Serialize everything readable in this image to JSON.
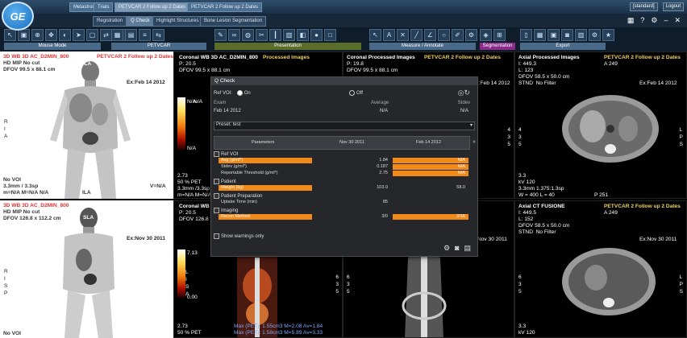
{
  "app": {
    "logo": "GE",
    "top_tabs": [
      {
        "label": "Metastroinnana",
        "active": false
      },
      {
        "label": "Trials",
        "active": false
      },
      {
        "label": "PETVCAR 2 Follow up 2 Dates",
        "active": true
      },
      {
        "label": "PETVCAR 2 Follow up 2 Dates",
        "active": false
      }
    ],
    "right_user": "[standard]",
    "logout": "Logout",
    "help": "?"
  },
  "sub_tabs": [
    {
      "label": "Registration",
      "active": false
    },
    {
      "label": "Q Check",
      "active": true
    },
    {
      "label": "Highlight Structures",
      "active": false
    },
    {
      "label": "Bone Lesion Segmentation",
      "active": false
    }
  ],
  "toolbar_groups": [
    {
      "name": "Mouse Mode",
      "icons": [
        "arrow-icon",
        "crop-icon",
        "zoom-icon",
        "pan-icon",
        "brightness-icon",
        "cursor-icon",
        "window-icon",
        "move-icon",
        "rotate-icon"
      ]
    },
    {
      "name": "PETVCAR",
      "icons": [
        "grid-icon",
        "layout-icon",
        "bars-icon",
        "swap-icon"
      ]
    },
    {
      "name": "Presentation",
      "icons": [
        "tool-icon",
        "link-icon",
        "paint-icon",
        "scissors-icon",
        "ruler-icon",
        "book-icon",
        "cube-icon",
        "blob-icon",
        "box-icon"
      ]
    },
    {
      "name": "Measure / Annotate",
      "icons": [
        "pointer-icon",
        "text-icon",
        "cross-icon",
        "line-icon",
        "angle-icon",
        "circle-icon",
        "draw-icon",
        "gear-icon"
      ]
    },
    {
      "name": "Segmentation",
      "icons": [
        "segment-icon",
        "merge-icon"
      ]
    },
    {
      "name": "Export",
      "icons": [
        "document-icon",
        "grid2-icon",
        "film-icon",
        "camera-icon",
        "film2-icon",
        "settings-icon",
        "run-icon"
      ]
    }
  ],
  "viewports": {
    "v1": {
      "title": "3D WB 3D AC_D2MIN_800",
      "series": "PETVCAR 2 Follow up 2 Dates",
      "l2": "HD MIP No cut",
      "l3": "DFOV 99.5 x 88.1 cm",
      "date": "Ex:Feb 14 2012",
      "ticks_left": [
        "R",
        "I",
        "A"
      ],
      "ticks_right": [
        "L",
        "P",
        "S"
      ],
      "cbar_top": "N/A",
      "cbar_bot": "N/A",
      "bottom": [
        "No VOI",
        "3.3mm / 3.3sp",
        "m=N/A M=N/A N/A"
      ],
      "bottom_right": "V=N/A",
      "label_mid": "ILA",
      "orient": "SLA"
    },
    "v2": {
      "title": "Coronal WB 3D AC_D2MIN_800",
      "sub": "Processed Images",
      "l2": "P: 20.5",
      "l3": "DFOV 99.5 x 88.1 cm",
      "bot1": "2.73",
      "bot2": "50 % PET",
      "bot3": "3.3mm /3.3sp",
      "bot4": "m=N/A M=N/A",
      "vnum": "N/A"
    },
    "v3": {
      "title": "Coronal Processed Images",
      "series": "PETVCAR 2 Follow up 2 Dates",
      "l2": "P: 19.8",
      "l3": "DFOV 99.5 x 88.1 cm",
      "date": "Ex:Feb 14 2012",
      "right_nums": [
        "4",
        "3",
        "5"
      ]
    },
    "v4": {
      "title": "Axial Processed Images",
      "series": "PETVCAR 2 Follow up 2 Dates",
      "l1": "I: 449.3",
      "l1b": "A 249",
      "l2": "L: 123",
      "l3": "DFOV 58.5 x 50.0 cm",
      "l4": "STND  No Filter",
      "date": "Ex:Feb 14 2012",
      "left_nums": [
        "4",
        "3",
        "5"
      ],
      "right_ticks": [
        "L",
        "P",
        "S"
      ],
      "bottom": [
        "3.3",
        "kV 120",
        "3.3mm 1.375:1.3sp",
        "W = 400 L = 40"
      ],
      "bottom_right": "P 251"
    },
    "v5": {
      "title": "3D WB 3D AC_D2MIN_800",
      "l2": "HD MIP No cut",
      "l3": "DFOV 126.8 x 112.2 cm",
      "date": "Ex:Nov 30 2011",
      "ticks_left": [
        "R",
        "I",
        "S",
        "P"
      ],
      "ticks_right": [
        "L",
        "I",
        "S",
        "A"
      ],
      "cbar_top": "7.13",
      "cbar_bot": "0.00",
      "bottom": [
        "No VOI"
      ],
      "orient": "SLA"
    },
    "v6": {
      "title": "Coronal WB 3D AC",
      "l2": "P: 20.5",
      "l3": "DFOV 126.8",
      "right_nums": [
        "6",
        "3",
        "5"
      ],
      "bottom": [
        "2.73",
        "50 % PET"
      ],
      "meas": "Max (PET): 1.55cm3 M=2.08 Av=1.84",
      "meas2": "Max (PET): 1.58cm3 M=5.89 Av=3.33"
    },
    "v7": {
      "date": "Nov 30 2011",
      "left_nums": [
        "6",
        "3",
        "5"
      ]
    },
    "v8": {
      "title": "Axial CT FUSIONE",
      "series": "PETVCAR 2 Follow up 2 Dates",
      "l1": "I: 449.5",
      "l1b": "A 249",
      "l2": "L: 152",
      "l3": "DFOV 58.5 x 50.0 cm",
      "l4": "STND  No Filter",
      "date": "Ex:Nov 30 2011",
      "left_nums": [
        "6",
        "3",
        "5"
      ],
      "right_ticks": [
        "L",
        "P",
        "S"
      ],
      "bottom": [
        "3.3",
        "kV 120"
      ]
    }
  },
  "qcheck": {
    "title": "Q Check",
    "ref_voi": "Ref VOI:",
    "on": "On",
    "off": "Off",
    "exam": "Exam",
    "average": "Average",
    "stdev": "Stdev",
    "exam_date": "Feb 14 2012",
    "avg_val": "N/A",
    "std_val": "N/A",
    "preset_label": "Preset:",
    "preset_val": "test",
    "col_params": "Parameters",
    "col_d1": "Nov 30 2011",
    "col_d2": "Feb 14 2012",
    "sections": [
      {
        "name": "Ref VOI",
        "rows": [
          {
            "param": "Avg (g/ml*)",
            "v1": "1.84",
            "v2": "N/A",
            "hl": true
          },
          {
            "param": "Stdev (g/ml*)",
            "v1": "0.187",
            "v2": "N/A",
            "hl": false
          },
          {
            "param": "Reportable Threshold (g/ml*)",
            "v1": "2.75",
            "v2": "N/A",
            "hl": false
          }
        ]
      },
      {
        "name": "Patient",
        "rows": [
          {
            "param": "Weight (kg)",
            "v1": "103.0",
            "v2": "58.0",
            "hl": true
          }
        ]
      },
      {
        "name": "Patient Preparation",
        "rows": [
          {
            "param": "Uptake Time (min)",
            "v1": "85",
            "v2": "",
            "hl": false
          }
        ]
      },
      {
        "name": "Imaging",
        "rows": [
          {
            "param": "Recon Method",
            "v1": "3/0",
            "v2": "2/16",
            "hl": true
          }
        ]
      }
    ],
    "show_warnings": "Show warnings only"
  }
}
